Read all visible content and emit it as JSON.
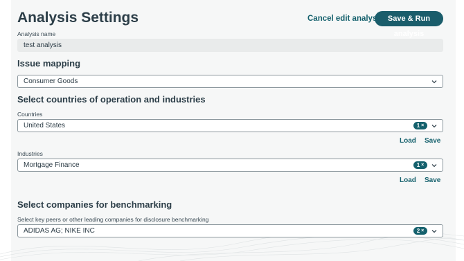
{
  "header": {
    "title": "Analysis Settings",
    "cancel_label": "Cancel edit analysis",
    "save_run_label": "Save & Run analysis"
  },
  "analysis_name": {
    "label": "Analysis name",
    "value": "test analysis"
  },
  "issue_mapping": {
    "title": "Issue mapping",
    "selected": "Consumer Goods"
  },
  "countries_industries": {
    "title": "Select countries of operation and industries",
    "countries": {
      "label": "Countries",
      "selected": "United States",
      "count": "1",
      "remove_glyph": "×",
      "load_label": "Load",
      "save_label": "Save"
    },
    "industries": {
      "label": "Industries",
      "selected": "Mortgage Finance",
      "count": "1",
      "remove_glyph": "×",
      "load_label": "Load",
      "save_label": "Save"
    }
  },
  "benchmarking": {
    "title": "Select companies for benchmarking",
    "label": "Select key peers or other leading companies for disclosure benchmarking",
    "selected": "ADIDAS AG; NIKE INC",
    "count": "2",
    "remove_glyph": "×"
  },
  "icons": {
    "dropdown": "chevron-down-icon",
    "clear": "close-icon"
  },
  "colors": {
    "accent": "#15616d",
    "button_bg": "#1a5d6b",
    "panel_bg": "#f6f7f7"
  }
}
